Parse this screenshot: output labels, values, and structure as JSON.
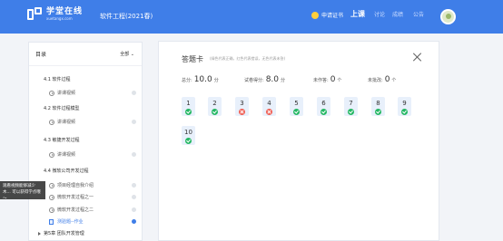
{
  "header": {
    "logo_cn": "学堂在线",
    "logo_en": "xuetangx.com",
    "course_title": "软件工程(2021春)",
    "cert_label": "申请证书",
    "nav": [
      "上课",
      "讨论",
      "成绩",
      "公告"
    ],
    "active_nav": "上课"
  },
  "sidebar": {
    "title": "目录",
    "filter": "全部",
    "sections": [
      {
        "label": "4.1 软件过程",
        "items": [
          {
            "label": "讲课视频",
            "done": false
          }
        ]
      },
      {
        "label": "4.2 软件过程模型",
        "items": [
          {
            "label": "讲课视频",
            "done": false
          }
        ]
      },
      {
        "label": "4.3 敏捷开发过程",
        "items": [
          {
            "label": "讲课视频",
            "done": false
          }
        ]
      },
      {
        "label": "4.4 微软公司开发过程",
        "items": [
          {
            "label": "项目经理自我介绍",
            "done": false
          },
          {
            "label": "微软开发过程之一",
            "done": false
          },
          {
            "label": "微软开发过程之二",
            "done": false
          },
          {
            "label": "测验题--作业",
            "done": true
          }
        ]
      }
    ],
    "next_chapter": "第5章 团队开发管理",
    "tooltip": "观看视频能够减少木... 可以获得学点哦～"
  },
  "answer_card": {
    "title": "答题卡",
    "subtitle": "(绿色代表正确，红色代表错误，无色代表未答)",
    "total_label": "总分:",
    "total_value": "10.0",
    "total_unit": "分",
    "score_label": "试卷得分:",
    "score_value": "8.0",
    "score_unit": "分",
    "unanswered_label": "未作答:",
    "unanswered_value": "0",
    "unanswered_unit": "个",
    "ungraded_label": "未批改:",
    "ungraded_value": "0",
    "ungraded_unit": "个",
    "questions": [
      {
        "n": "1",
        "status": "ok"
      },
      {
        "n": "2",
        "status": "ok"
      },
      {
        "n": "3",
        "status": "bad"
      },
      {
        "n": "4",
        "status": "bad"
      },
      {
        "n": "5",
        "status": "ok"
      },
      {
        "n": "6",
        "status": "ok"
      },
      {
        "n": "7",
        "status": "ok"
      },
      {
        "n": "8",
        "status": "ok"
      },
      {
        "n": "9",
        "status": "ok"
      },
      {
        "n": "10",
        "status": "ok"
      }
    ]
  },
  "colors": {
    "primary": "#3f7ee8",
    "correct": "#25b864",
    "wrong": "#f05a4f"
  }
}
